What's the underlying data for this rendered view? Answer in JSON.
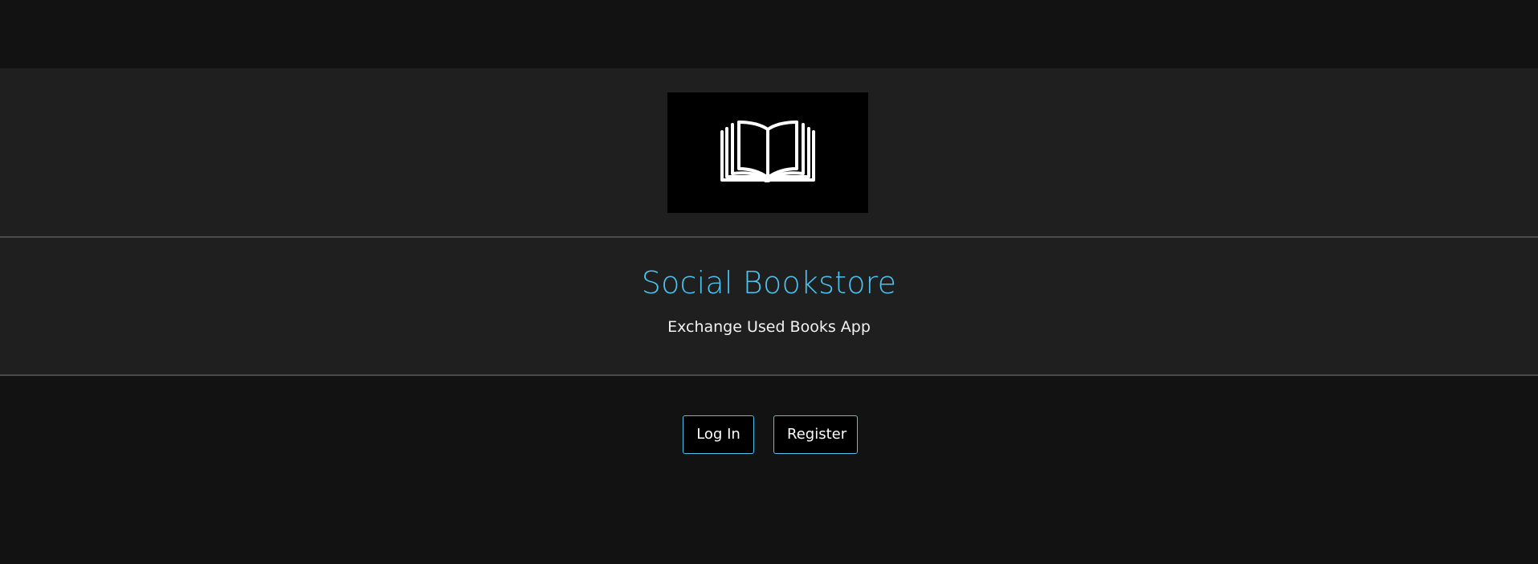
{
  "hero": {
    "logo_icon": "open-book-icon",
    "title": "Social Bookstore",
    "subtitle": "Exchange Used Books App"
  },
  "actions": {
    "login_label": "Log In",
    "register_label": "Register"
  },
  "colors": {
    "page_background": "#121212",
    "hero_background": "#1f1f1f",
    "accent": "#4cc3ef",
    "button_background": "#000000",
    "text": "#ffffff"
  }
}
